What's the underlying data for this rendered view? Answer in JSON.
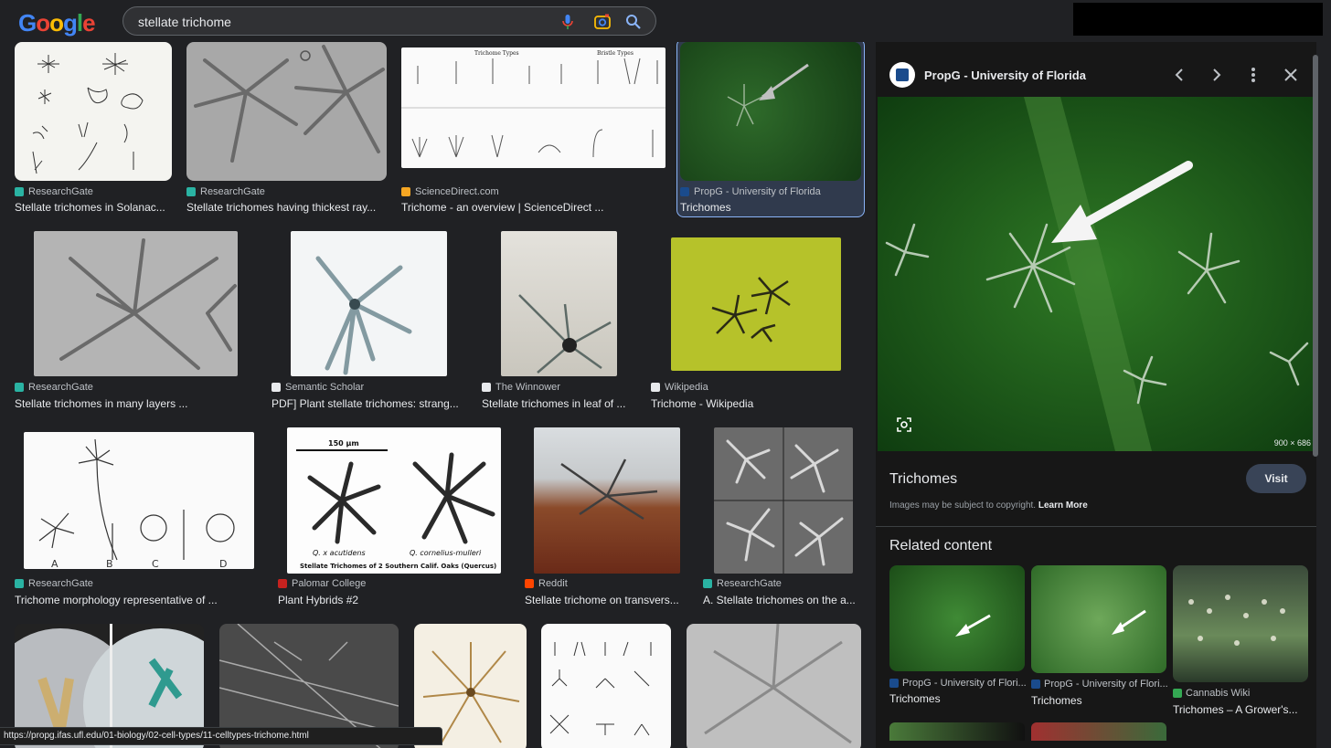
{
  "search": {
    "query": "stellate trichome"
  },
  "logo_text": "Google",
  "grid": {
    "row1": [
      {
        "source": "ResearchGate",
        "title": "Stellate trichomes in Solanac...",
        "favicon_color": "#2ab3a3"
      },
      {
        "source": "ResearchGate",
        "title": "Stellate trichomes having thickest ray...",
        "favicon_color": "#2ab3a3"
      },
      {
        "source": "ScienceDirect.com",
        "title": "Trichome - an overview | ScienceDirect ...",
        "favicon_color": "#f5a623"
      },
      {
        "source": "PropG - University of Florida",
        "title": "Trichomes",
        "favicon_color": "#1a4b8c"
      }
    ],
    "row2": [
      {
        "source": "ResearchGate",
        "title": "Stellate trichomes in many layers ...",
        "favicon_color": "#2ab3a3"
      },
      {
        "source": "Semantic Scholar",
        "title": "PDF] Plant stellate trichomes: strang...",
        "favicon_color": "#e8eaed"
      },
      {
        "source": "The Winnower",
        "title": "Stellate trichomes in leaf of ...",
        "favicon_color": "#e8eaed"
      },
      {
        "source": "Wikipedia",
        "title": "Trichome - Wikipedia",
        "favicon_color": "#e8eaed"
      }
    ],
    "row3": [
      {
        "source": "ResearchGate",
        "title": "Trichome morphology representative of ...",
        "favicon_color": "#2ab3a3"
      },
      {
        "source": "Palomar College",
        "title": "Plant Hybrids #2",
        "favicon_color": "#c5221f"
      },
      {
        "source": "Reddit",
        "title": "Stellate trichome on transvers...",
        "favicon_color": "#ff4500"
      },
      {
        "source": "ResearchGate",
        "title": "A. Stellate trichomes on the a...",
        "favicon_color": "#2ab3a3"
      }
    ],
    "figure_labels": {
      "trichome_types": "Trichome Types",
      "bristle_types": "Bristle Types",
      "scale": "150 µm",
      "oak_a": "Q. x acutidens",
      "oak_b": "Q. cornelius-mulleri",
      "oak_caption": "Stellate Trichomes of 2 Southern Calif. Oaks (Quercus)",
      "letters": [
        "A",
        "B",
        "C",
        "D"
      ]
    }
  },
  "panel": {
    "site_name": "PropG - University of Florida",
    "dimensions": "900 × 686",
    "title": "Trichomes",
    "visit_label": "Visit",
    "copyright_text": "Images may be subject to copyright.",
    "learn_more": "Learn More",
    "related_heading": "Related content",
    "related": [
      {
        "source": "PropG - University of Flori...",
        "title": "Trichomes",
        "favicon_color": "#1a4b8c"
      },
      {
        "source": "PropG - University of Flori...",
        "title": "Trichomes",
        "favicon_color": "#1a4b8c"
      },
      {
        "source": "Cannabis Wiki",
        "title": "Trichomes – A Grower's...",
        "favicon_color": "#34a853"
      }
    ]
  },
  "status_url": "https://propg.ifas.ufl.edu/01-biology/02-cell-types/11-celltypes-trichome.html"
}
